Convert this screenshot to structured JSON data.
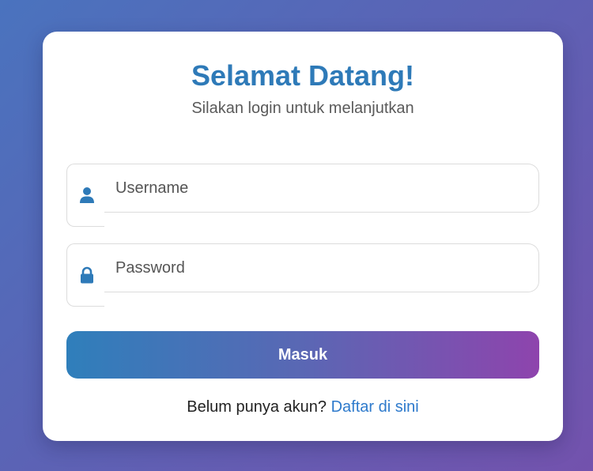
{
  "header": {
    "title": "Selamat Datang!",
    "subtitle": "Silakan login untuk melanjutkan"
  },
  "form": {
    "username": {
      "icon": "user-icon",
      "value": "",
      "placeholder": "Username"
    },
    "password": {
      "icon": "lock-icon",
      "value": "",
      "placeholder": "Password"
    },
    "submit_label": "Masuk"
  },
  "footer": {
    "prompt": "Belum punya akun?",
    "link_label": "Daftar di sini"
  },
  "colors": {
    "accent": "#2e7ab8",
    "link": "#2e7acc",
    "button_gradient_start": "#2f7fbb",
    "button_gradient_end": "#8e44ad"
  }
}
